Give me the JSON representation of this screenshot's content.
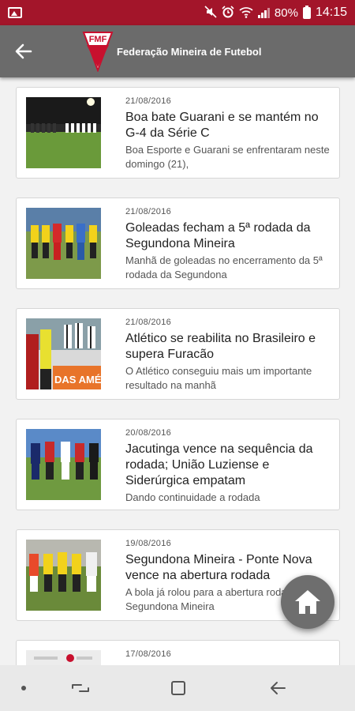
{
  "status_bar": {
    "battery_text": "80%",
    "time": "14:15"
  },
  "app_bar": {
    "logo_text": "FMF",
    "title": "Federação Mineira de Futebol"
  },
  "news": [
    {
      "date": "21/08/2016",
      "title": "Boa bate Guarani e se mantém no G-4 da Série C",
      "summary": "Boa Esporte e Guarani se enfrentaram neste domingo (21),"
    },
    {
      "date": "21/08/2016",
      "title": "Goleadas fecham a 5ª rodada da Segundona Mineira",
      "summary": "Manhã de goleadas no encerramento da 5ª rodada da Segundona"
    },
    {
      "date": "21/08/2016",
      "title": "Atlético se reabilita no Brasileiro e supera Furacão",
      "summary": "O Atlético conseguiu mais um importante resultado na manhã"
    },
    {
      "date": "20/08/2016",
      "title": "Jacutinga vence na sequência da rodada; União Luziense e Siderúrgica empatam",
      "summary": "Dando continuidade a rodada"
    },
    {
      "date": "19/08/2016",
      "title": "Segundona Mineira - Ponte Nova vence na abertura rodada",
      "summary": "A bola já rolou para a abertura rodada da Segundona Mineira"
    },
    {
      "date": "17/08/2016",
      "title": "",
      "summary": ""
    }
  ],
  "thumb_banner_text": "DAS AMÉ",
  "icons": {
    "back": "arrow-left-icon",
    "home": "home-icon",
    "recent_apps": "recent-apps-icon",
    "overview": "square-icon",
    "nav_back": "nav-back-icon"
  },
  "colors": {
    "status_bar": "#a3152a",
    "app_bar": "#6b6b6b",
    "fab": "#6e6e6e",
    "nav_bar": "#e9e9e9",
    "logo_red": "#c8102e"
  }
}
